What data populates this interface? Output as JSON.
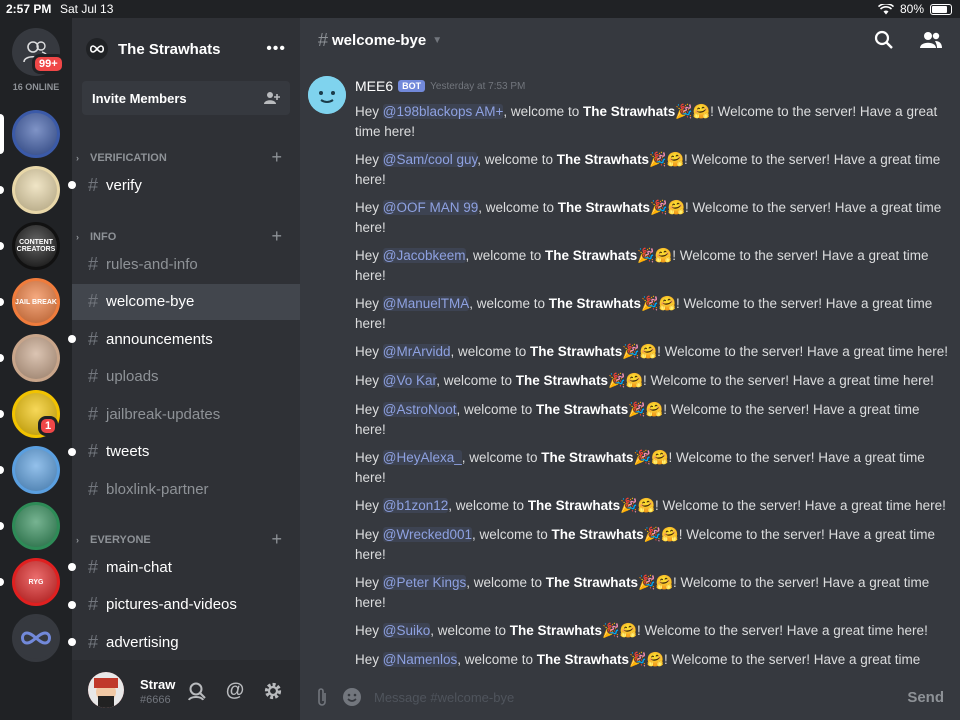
{
  "status_bar": {
    "time": "2:57 PM",
    "date": "Sat Jul 13",
    "battery": "80%"
  },
  "rail": {
    "home_badge": "99+",
    "online_label": "16 ONLINE",
    "servers": [
      {
        "color": "#3b5aa8",
        "label": "",
        "dot": false
      },
      {
        "color": "#e8d7a8",
        "label": "",
        "dot": true
      },
      {
        "color": "#111111",
        "label": "CONTENT CREATORS",
        "dot": true
      },
      {
        "color": "#f07c3c",
        "label": "JAIL BREAK",
        "dot": true
      },
      {
        "color": "#c8a58a",
        "label": "",
        "dot": true
      },
      {
        "color": "#f2c300",
        "label": "",
        "dot": true,
        "badge": "1"
      },
      {
        "color": "#5a9fe0",
        "label": "",
        "dot": true
      },
      {
        "color": "#2e8b57",
        "label": "",
        "dot": true
      },
      {
        "color": "#e02020",
        "label": "RYG",
        "dot": true
      },
      {
        "color": "#36393f",
        "label": "",
        "dot": false
      }
    ]
  },
  "guild": {
    "name": "The Strawhats",
    "invite_label": "Invite Members",
    "categories": [
      {
        "name": "VERIFICATION",
        "channels": [
          {
            "name": "verify",
            "unread": true
          }
        ]
      },
      {
        "name": "INFO",
        "channels": [
          {
            "name": "rules-and-info",
            "unread": false
          },
          {
            "name": "welcome-bye",
            "unread": false,
            "selected": true
          },
          {
            "name": "announcements",
            "unread": true
          },
          {
            "name": "uploads",
            "unread": false
          },
          {
            "name": "jailbreak-updates",
            "unread": false
          },
          {
            "name": "tweets",
            "unread": true
          },
          {
            "name": "bloxlink-partner",
            "unread": false
          }
        ]
      },
      {
        "name": "EVERYONE",
        "channels": [
          {
            "name": "main-chat",
            "unread": true
          },
          {
            "name": "pictures-and-videos",
            "unread": true
          },
          {
            "name": "advertising",
            "unread": true
          }
        ]
      }
    ]
  },
  "user": {
    "name": "Straw",
    "tag": "#6666"
  },
  "chat": {
    "channel_name": "welcome-bye",
    "author": "MEE6",
    "bot_tag": "BOT",
    "timestamp": "Yesterday at 7:53 PM",
    "input_placeholder": "Message #welcome-bye",
    "send_label": "Send",
    "message_parts": {
      "prefix": "Hey ",
      "middle": ", welcome to ",
      "server": "The Strawhats",
      "suffix": " ! Welcome to the server! Have a great time here!",
      "first_suffix": " ! Welcome to the server! Have a great time here!"
    },
    "messages": [
      {
        "mention": "@198blackops AM+",
        "first": true,
        "wrap": "! Welcome to the server! Have a great",
        "wrap2": "time here!"
      },
      {
        "mention": "@Sam/cool guy",
        "wrap": "! Welcome to the server! Have a great time",
        "wrap2": "here!"
      },
      {
        "mention": "@OOF MAN 99",
        "wrap": "! Welcome to the server! Have a great time",
        "wrap2": "here!"
      },
      {
        "mention": "@Jacobkeem",
        "wrap": "! Welcome to the server! Have a great time",
        "wrap2": "here!"
      },
      {
        "mention": "@ManuelTMA",
        "wrap": "! Welcome to the server! Have a great time",
        "wrap2": "here!"
      },
      {
        "mention": "@MrArvidd",
        "wrap": "! Welcome to the server! Have a great time here!",
        "wrap2": ""
      },
      {
        "mention": "@Vo Kar",
        "wrap": "! Welcome to the server! Have a great time here!",
        "wrap2": ""
      },
      {
        "mention": "@AstroNoot",
        "wrap": "! Welcome to the server! Have a great time",
        "wrap2": "here!"
      },
      {
        "mention": "@HeyAlexa_",
        "wrap": "! Welcome to the server! Have a great time",
        "wrap2": "here!"
      },
      {
        "mention": "@b1zon12",
        "wrap": "! Welcome to the server! Have a great time here!",
        "wrap2": ""
      },
      {
        "mention": "@Wrecked001",
        "wrap": "! Welcome to the server! Have a great time",
        "wrap2": "here!"
      },
      {
        "mention": "@Peter Kings",
        "wrap": "! Welcome to the server! Have a great time",
        "wrap2": "here!"
      },
      {
        "mention": "@Suiko",
        "wrap": "! Welcome to the server! Have a great time here!",
        "wrap2": ""
      },
      {
        "mention": "@Namenlos",
        "wrap": "! Welcome to the server! Have a great time here!",
        "wrap2": ""
      }
    ],
    "emoji": "🎉🤗"
  },
  "colors": {
    "accent": "#7289da",
    "mention": "#8ea1e1",
    "badge": "#f04747"
  }
}
